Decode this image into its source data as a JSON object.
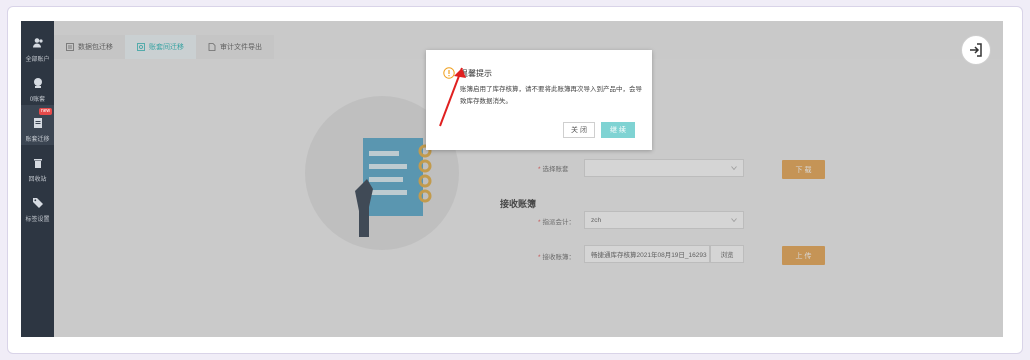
{
  "sidebar": {
    "items": [
      {
        "label": "全部账户",
        "icon": "users-icon"
      },
      {
        "label": "0账套",
        "icon": "coin-icon"
      },
      {
        "label": "账套迁移",
        "icon": "document-icon",
        "badge": "new"
      },
      {
        "label": "回收站",
        "icon": "trash-icon"
      },
      {
        "label": "标签设置",
        "icon": "tag-icon"
      }
    ]
  },
  "tabs": [
    {
      "label": "数据包迁移",
      "icon": "package-icon"
    },
    {
      "label": "账套间迁移",
      "icon": "transfer-icon"
    },
    {
      "label": "审计文件导出",
      "icon": "file-export-icon"
    }
  ],
  "form": {
    "source_select_label": "选择账套",
    "source_select_value": "",
    "download_button": "下 载",
    "receive_section_title": "接收账簿",
    "accountant_label": "指派会计：",
    "accountant_value": "zch",
    "receive_label": "接收账簿：",
    "receive_value": "畅捷通库存核算2021年08月19日_16293",
    "browse_button": "浏览",
    "upload_button": "上 传"
  },
  "dialog": {
    "title": "温馨提示",
    "message": "账簿启用了库存核算，请不要将此账簿再次导入到产品中，会导致库存数据消失。",
    "close_button": "关 闭",
    "continue_button": "继 续"
  },
  "colors": {
    "sidebar_bg": "#2d3642",
    "accent_teal": "#1fb3b3",
    "button_orange": "#e3a04a",
    "warning_orange": "#f0a020",
    "annotation_red": "#e02020"
  }
}
